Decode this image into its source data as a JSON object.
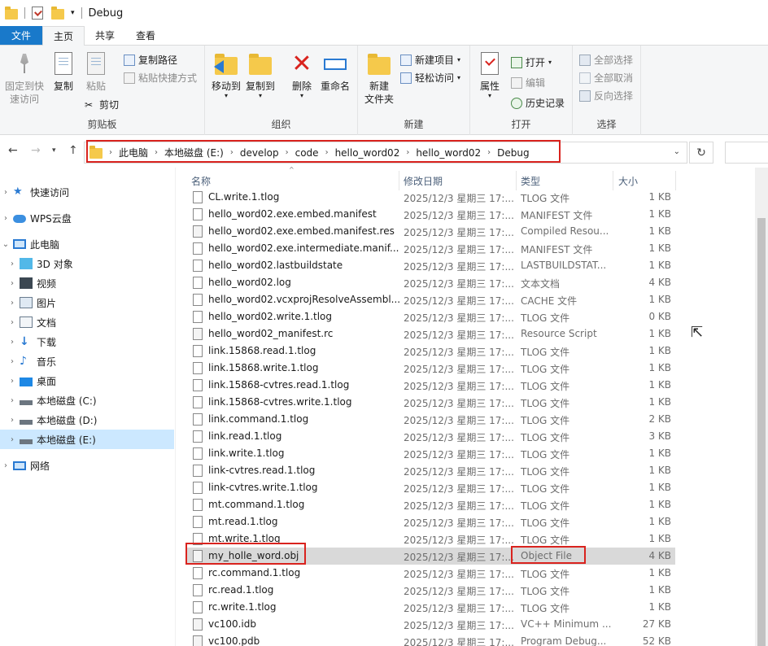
{
  "window": {
    "title": "Debug"
  },
  "tabs": [
    {
      "label": "文件"
    },
    {
      "label": "主页"
    },
    {
      "label": "共享"
    },
    {
      "label": "查看"
    }
  ],
  "ribbon": {
    "clipboard": {
      "label": "剪贴板",
      "pin_label_1": "固定到快",
      "pin_label_2": "速访问",
      "copy": "复制",
      "paste": "粘贴",
      "copy_path": "复制路径",
      "paste_shortcut": "粘贴快捷方式",
      "cut": "剪切"
    },
    "organize": {
      "label": "组织",
      "move_to": "移动到",
      "copy_to": "复制到",
      "delete": "删除",
      "rename": "重命名"
    },
    "new": {
      "label": "新建",
      "new_folder_1": "新建",
      "new_folder_2": "文件夹",
      "new_item": "新建项目",
      "easy_access": "轻松访问"
    },
    "open": {
      "label": "打开",
      "properties": "属性",
      "open": "打开",
      "edit": "编辑",
      "history": "历史记录"
    },
    "select": {
      "label": "选择",
      "select_all": "全部选择",
      "select_none": "全部取消",
      "invert": "反向选择"
    }
  },
  "address": {
    "crumbs": [
      "此电脑",
      "本地磁盘 (E:)",
      "develop",
      "code",
      "hello_word02",
      "hello_word02",
      "Debug"
    ]
  },
  "navpane": {
    "items": [
      {
        "label": "快速访问"
      },
      {
        "label": "WPS云盘"
      },
      {
        "label": "此电脑"
      },
      {
        "label": "3D 对象"
      },
      {
        "label": "视频"
      },
      {
        "label": "图片"
      },
      {
        "label": "文档"
      },
      {
        "label": "下载"
      },
      {
        "label": "音乐"
      },
      {
        "label": "桌面"
      },
      {
        "label": "本地磁盘 (C:)"
      },
      {
        "label": "本地磁盘 (D:)"
      },
      {
        "label": "本地磁盘 (E:)"
      },
      {
        "label": "网络"
      }
    ]
  },
  "columns": {
    "name": "名称",
    "date": "修改日期",
    "type": "类型",
    "size": "大小"
  },
  "files": [
    {
      "name": "CL.write.1.tlog",
      "date": "2025/12/3 星期三 17:...",
      "type": "TLOG 文件",
      "size": "1 KB"
    },
    {
      "name": "hello_word02.exe.embed.manifest",
      "date": "2025/12/3 星期三 17:...",
      "type": "MANIFEST 文件",
      "size": "1 KB"
    },
    {
      "name": "hello_word02.exe.embed.manifest.res",
      "date": "2025/12/3 星期三 17:...",
      "type": "Compiled Resou...",
      "size": "1 KB"
    },
    {
      "name": "hello_word02.exe.intermediate.manif...",
      "date": "2025/12/3 星期三 17:...",
      "type": "MANIFEST 文件",
      "size": "1 KB"
    },
    {
      "name": "hello_word02.lastbuildstate",
      "date": "2025/12/3 星期三 17:...",
      "type": "LASTBUILDSTAT...",
      "size": "1 KB"
    },
    {
      "name": "hello_word02.log",
      "date": "2025/12/3 星期三 17:...",
      "type": "文本文档",
      "size": "4 KB"
    },
    {
      "name": "hello_word02.vcxprojResolveAssembl...",
      "date": "2025/12/3 星期三 17:...",
      "type": "CACHE 文件",
      "size": "1 KB"
    },
    {
      "name": "hello_word02.write.1.tlog",
      "date": "2025/12/3 星期三 17:...",
      "type": "TLOG 文件",
      "size": "0 KB"
    },
    {
      "name": "hello_word02_manifest.rc",
      "date": "2025/12/3 星期三 17:...",
      "type": "Resource Script",
      "size": "1 KB"
    },
    {
      "name": "link.15868.read.1.tlog",
      "date": "2025/12/3 星期三 17:...",
      "type": "TLOG 文件",
      "size": "1 KB"
    },
    {
      "name": "link.15868.write.1.tlog",
      "date": "2025/12/3 星期三 17:...",
      "type": "TLOG 文件",
      "size": "1 KB"
    },
    {
      "name": "link.15868-cvtres.read.1.tlog",
      "date": "2025/12/3 星期三 17:...",
      "type": "TLOG 文件",
      "size": "1 KB"
    },
    {
      "name": "link.15868-cvtres.write.1.tlog",
      "date": "2025/12/3 星期三 17:...",
      "type": "TLOG 文件",
      "size": "1 KB"
    },
    {
      "name": "link.command.1.tlog",
      "date": "2025/12/3 星期三 17:...",
      "type": "TLOG 文件",
      "size": "2 KB"
    },
    {
      "name": "link.read.1.tlog",
      "date": "2025/12/3 星期三 17:...",
      "type": "TLOG 文件",
      "size": "3 KB"
    },
    {
      "name": "link.write.1.tlog",
      "date": "2025/12/3 星期三 17:...",
      "type": "TLOG 文件",
      "size": "1 KB"
    },
    {
      "name": "link-cvtres.read.1.tlog",
      "date": "2025/12/3 星期三 17:...",
      "type": "TLOG 文件",
      "size": "1 KB"
    },
    {
      "name": "link-cvtres.write.1.tlog",
      "date": "2025/12/3 星期三 17:...",
      "type": "TLOG 文件",
      "size": "1 KB"
    },
    {
      "name": "mt.command.1.tlog",
      "date": "2025/12/3 星期三 17:...",
      "type": "TLOG 文件",
      "size": "1 KB"
    },
    {
      "name": "mt.read.1.tlog",
      "date": "2025/12/3 星期三 17:...",
      "type": "TLOG 文件",
      "size": "1 KB"
    },
    {
      "name": "mt.write.1.tlog",
      "date": "2025/12/3 星期三 17:...",
      "type": "TLOG 文件",
      "size": "1 KB"
    },
    {
      "name": "my_holle_word.obj",
      "date": "2025/12/3 星期三 17:...",
      "type": "Object File",
      "size": "4 KB"
    },
    {
      "name": "rc.command.1.tlog",
      "date": "2025/12/3 星期三 17:...",
      "type": "TLOG 文件",
      "size": "1 KB"
    },
    {
      "name": "rc.read.1.tlog",
      "date": "2025/12/3 星期三 17:...",
      "type": "TLOG 文件",
      "size": "1 KB"
    },
    {
      "name": "rc.write.1.tlog",
      "date": "2025/12/3 星期三 17:...",
      "type": "TLOG 文件",
      "size": "1 KB"
    },
    {
      "name": "vc100.idb",
      "date": "2025/12/3 星期三 17:...",
      "type": "VC++ Minimum ...",
      "size": "27 KB"
    },
    {
      "name": "vc100.pdb",
      "date": "2025/12/3 星期三 17:...",
      "type": "Program Debug...",
      "size": "52 KB"
    }
  ],
  "colors": {
    "accent": "#1979ca",
    "highlight": "#d9231e",
    "selection": "#cce8ff"
  }
}
